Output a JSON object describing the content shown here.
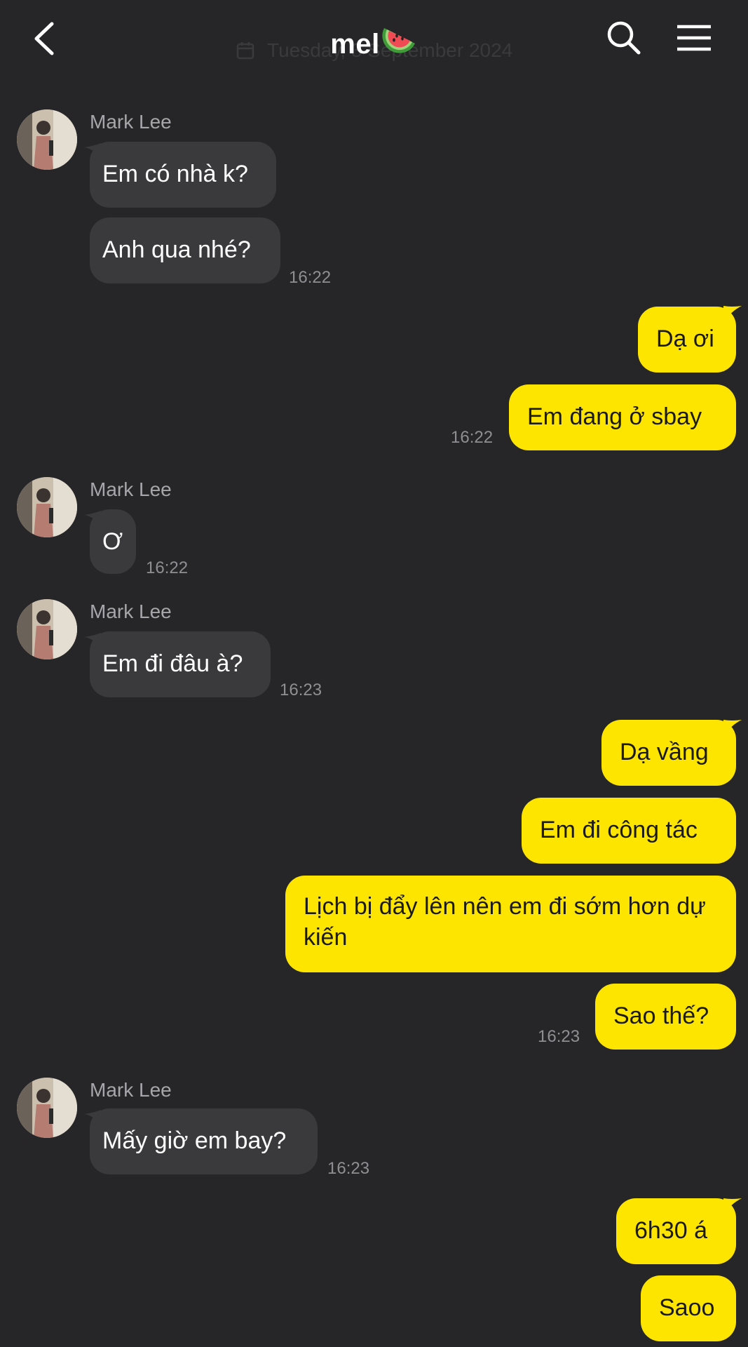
{
  "header": {
    "title": "mel",
    "date_label": "Tuesday, 3 September 2024"
  },
  "messages": [
    {
      "sender": "Mark Lee",
      "text": "Em có nhà k?"
    },
    {
      "text": "Anh qua nhé?",
      "time": "16:22"
    },
    {
      "text": "Dạ ơi"
    },
    {
      "text": "Em đang ở sbay",
      "time": "16:22"
    },
    {
      "sender": "Mark Lee",
      "text": "Ơ",
      "time": "16:22"
    },
    {
      "sender": "Mark Lee",
      "text": "Em đi đâu à?",
      "time": "16:23"
    },
    {
      "text": "Dạ vầng"
    },
    {
      "text": "Em đi công tác"
    },
    {
      "text": "Lịch bị đẩy lên nên em đi sớm hơn dự kiến"
    },
    {
      "text": "Sao thế?",
      "time": "16:23"
    },
    {
      "sender": "Mark Lee",
      "text": "Mấy giờ em bay?",
      "time": "16:23"
    },
    {
      "text": "6h30 á"
    },
    {
      "text": "Saoo"
    }
  ],
  "colors": {
    "background": "#262628",
    "incoming_bubble": "#3a3a3c",
    "outgoing_bubble": "#fee500"
  },
  "icons": [
    "back-arrow-icon",
    "watermelon-icon",
    "calendar-icon",
    "search-icon",
    "menu-icon",
    "avatar"
  ]
}
